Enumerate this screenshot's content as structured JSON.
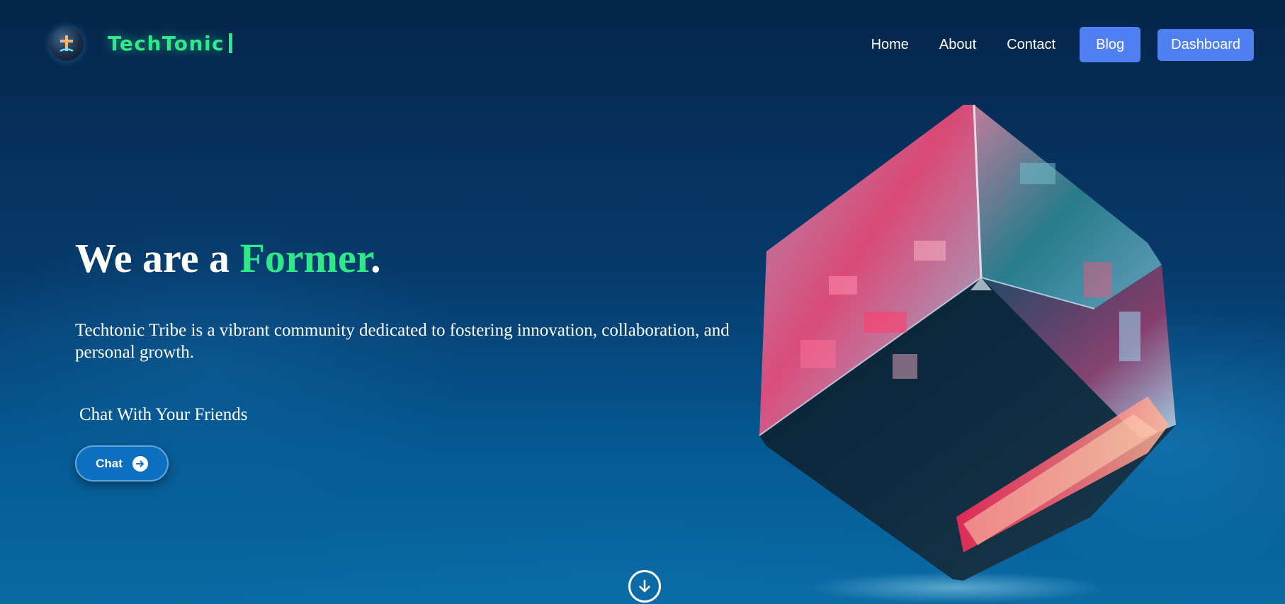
{
  "header": {
    "brand": "TechTonic",
    "logo_icon": "techtonic-logo-icon",
    "nav": {
      "home": "Home",
      "about": "About",
      "contact": "Contact",
      "blog": "Blog",
      "dashboard": "Dashboard"
    }
  },
  "hero": {
    "title_prefix": "We are a ",
    "title_accent": "Former",
    "title_suffix": ".",
    "description": "Techtonic Tribe is a vibrant community dedicated to fostering innovation, collaboration, and personal growth.",
    "chat_label": "Chat With Your Friends",
    "chat_button": "Chat",
    "chat_icon": "arrow-right-icon",
    "scroll_icon": "arrow-down-icon"
  },
  "colors": {
    "accent_green": "#2ee98a",
    "button_blue": "#4f7ff0",
    "chat_blue": "#0c6fbf",
    "background": "#06254a"
  }
}
